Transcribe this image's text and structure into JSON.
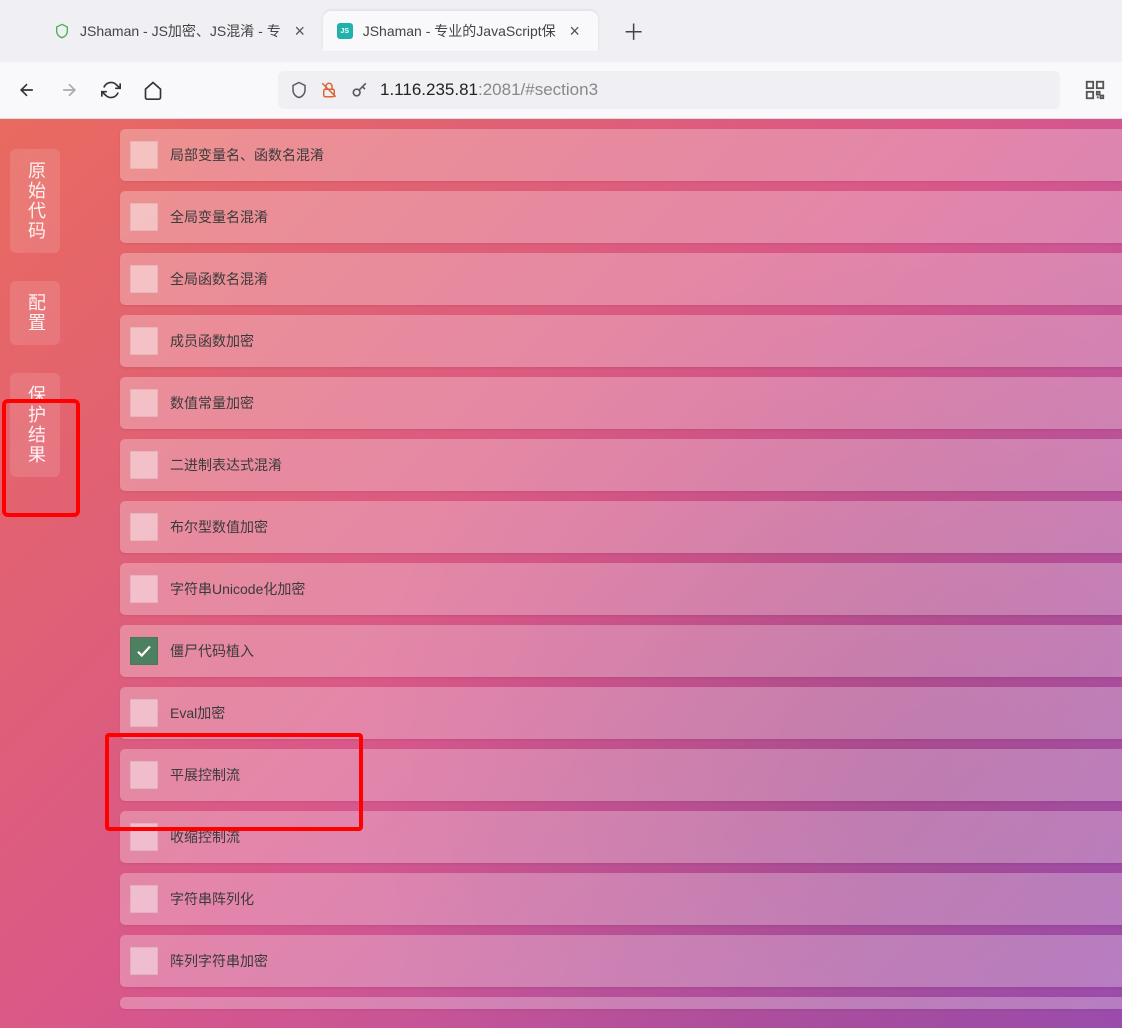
{
  "tabs": [
    {
      "title": "JShaman - JS加密、JS混淆 - 专",
      "active": false
    },
    {
      "title": "JShaman - 专业的JavaScript保",
      "active": true
    }
  ],
  "url": {
    "host": "1.116.235.81",
    "port": ":2081",
    "path": "/#section3"
  },
  "sideNav": [
    {
      "label": "原始代码"
    },
    {
      "label": "配置"
    },
    {
      "label": "保护结果"
    }
  ],
  "options": [
    {
      "label": "局部变量名、函数名混淆",
      "checked": false
    },
    {
      "label": "全局变量名混淆",
      "checked": false
    },
    {
      "label": "全局函数名混淆",
      "checked": false
    },
    {
      "label": "成员函数加密",
      "checked": false
    },
    {
      "label": "数值常量加密",
      "checked": false
    },
    {
      "label": "二进制表达式混淆",
      "checked": false
    },
    {
      "label": "布尔型数值加密",
      "checked": false
    },
    {
      "label": "字符串Unicode化加密",
      "checked": false
    },
    {
      "label": "僵尸代码植入",
      "checked": true
    },
    {
      "label": "Eval加密",
      "checked": false
    },
    {
      "label": "平展控制流",
      "checked": false
    },
    {
      "label": "收缩控制流",
      "checked": false
    },
    {
      "label": "字符串阵列化",
      "checked": false
    },
    {
      "label": "阵列字符串加密",
      "checked": false
    }
  ]
}
